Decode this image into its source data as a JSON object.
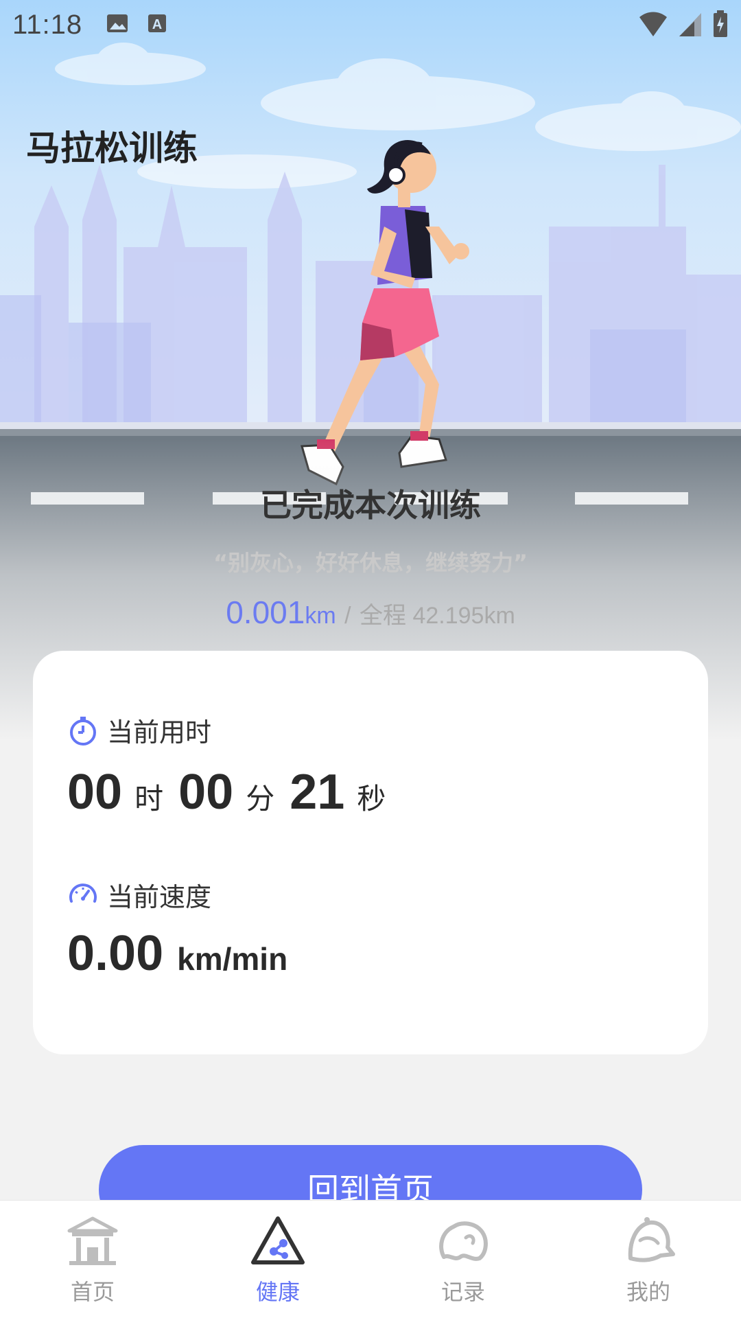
{
  "status_bar": {
    "time": "11:18",
    "icons_left": [
      "image-icon",
      "font-a-icon"
    ],
    "icons_right": [
      "wifi-icon",
      "signal-icon",
      "battery-charging-icon"
    ]
  },
  "header": {
    "title": "马拉松训练"
  },
  "completion": {
    "title": "已完成本次训练",
    "quote": "“别灰心，好好休息，继续努力”"
  },
  "distance": {
    "value": "0.001",
    "unit": "km",
    "separator": "/",
    "total": "全程 42.195km"
  },
  "stats": {
    "time_label": "当前用时",
    "hours": "00",
    "hours_unit": "时",
    "minutes": "00",
    "minutes_unit": "分",
    "seconds": "21",
    "seconds_unit": "秒",
    "speed_label": "当前速度",
    "speed_value": "0.00",
    "speed_unit": "km/min"
  },
  "actions": {
    "home_button": "回到首页"
  },
  "nav": {
    "items": [
      {
        "label": "首页",
        "icon": "pavilion-icon",
        "active": false
      },
      {
        "label": "健康",
        "icon": "health-triangle-icon",
        "active": true
      },
      {
        "label": "记录",
        "icon": "record-cloud-icon",
        "active": false
      },
      {
        "label": "我的",
        "icon": "profile-bell-icon",
        "active": false
      }
    ]
  },
  "colors": {
    "accent": "#6476f5",
    "distance_blue": "#6b7bf1",
    "sky": "#a9d6fb",
    "road": "#6f7a84"
  }
}
